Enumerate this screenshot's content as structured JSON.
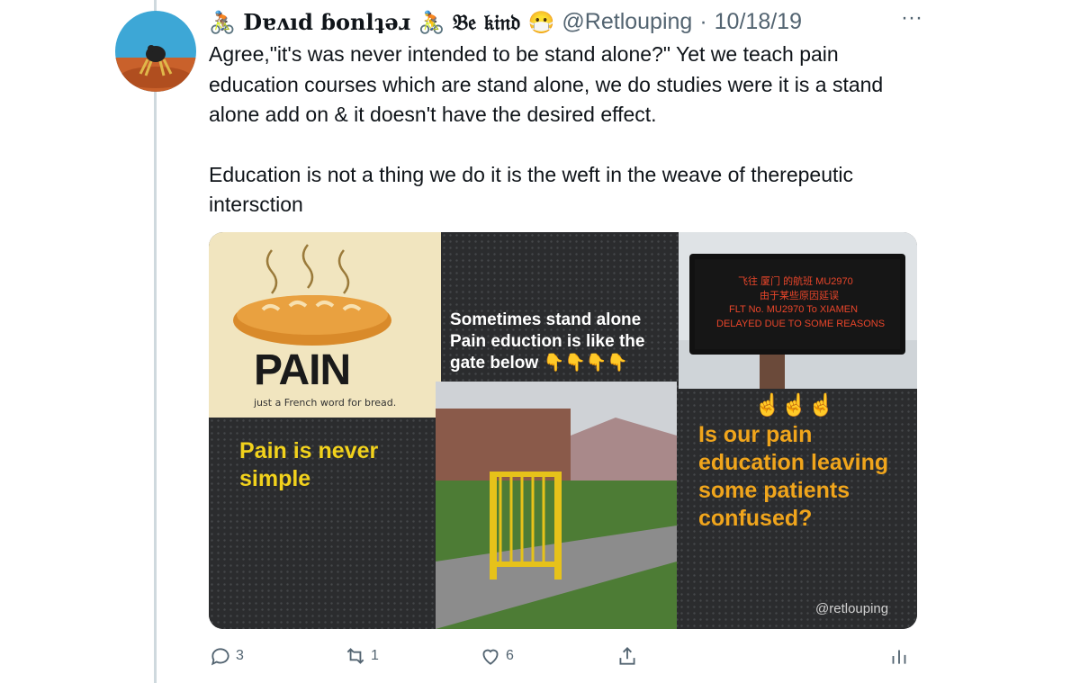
{
  "tweet": {
    "display_name": "🚴🏽 Dɐʌıd ɓonlʇǝɹ 🚴 𝔅𝔢 𝔨𝔦𝔫𝔡 😷",
    "handle": "@Retlouping",
    "separator": "·",
    "date": "10/18/19",
    "more_label": "···",
    "text_line_1": "Agree,\"it's was never intended to be stand alone?\" Yet we teach pain education courses which are stand alone, we do studies were it is a stand alone add on & it doesn't have the desired effect.",
    "text_line_2": "Education is not a thing we do it is the weft in the weave of therepeutic intersction"
  },
  "media": {
    "pain_word": "PAIN",
    "pain_caption": "just a French word for bread.",
    "left_caption": "Pain is never simple",
    "middle_caption": "Sometimes stand alone Pain eduction is like the gate below 👇👇👇👇",
    "right_emojis": "☝️☝️☝️",
    "right_caption": "Is our pain education leaving some patients confused?",
    "watermark": "@retlouping",
    "board_line_1": "飞往 厦门 的航班 MU2970",
    "board_line_2": "由于某些原因延误",
    "board_line_3": "FLT No. MU2970  To XIAMEN",
    "board_line_4": "DELAYED DUE TO SOME REASONS"
  },
  "actions": {
    "reply_count": "3",
    "retweet_count": "1",
    "like_count": "6"
  },
  "colors": {
    "text": "#0f1419",
    "muted": "#536471",
    "yellow": "#f2d21c",
    "orange": "#f0a51c",
    "dark_panel": "#2b2c2e"
  }
}
